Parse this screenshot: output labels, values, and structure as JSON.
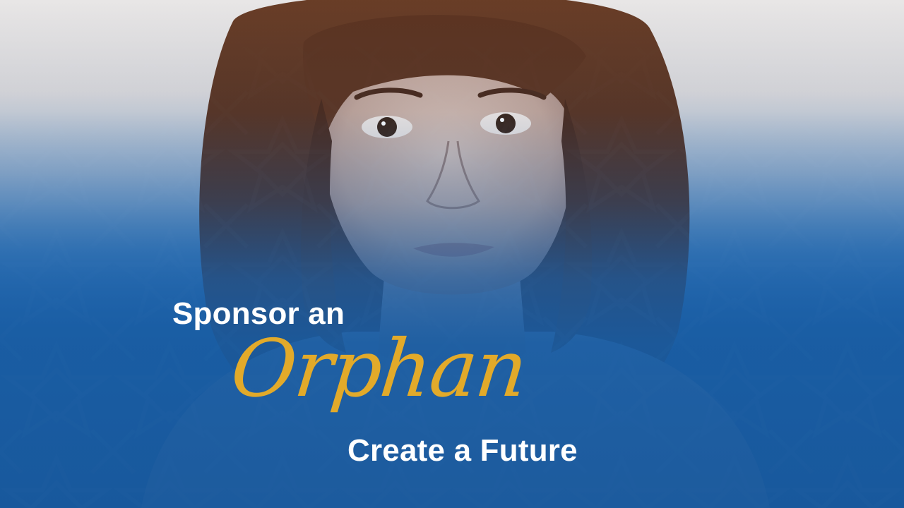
{
  "headline": {
    "line1": "Sponsor an",
    "script_word": "Orphan",
    "line3": "Create a Future"
  },
  "colors": {
    "background_top": "#e8e6e6",
    "background_blue": "#1c5fa3",
    "headline_text": "#ffffff",
    "script_accent": "#e2aa2a",
    "hair": "#5a3422",
    "skin": "#c9b1a7"
  },
  "imagery": {
    "subject": "portrait-of-girl",
    "pattern": "geometric-star-pattern"
  }
}
